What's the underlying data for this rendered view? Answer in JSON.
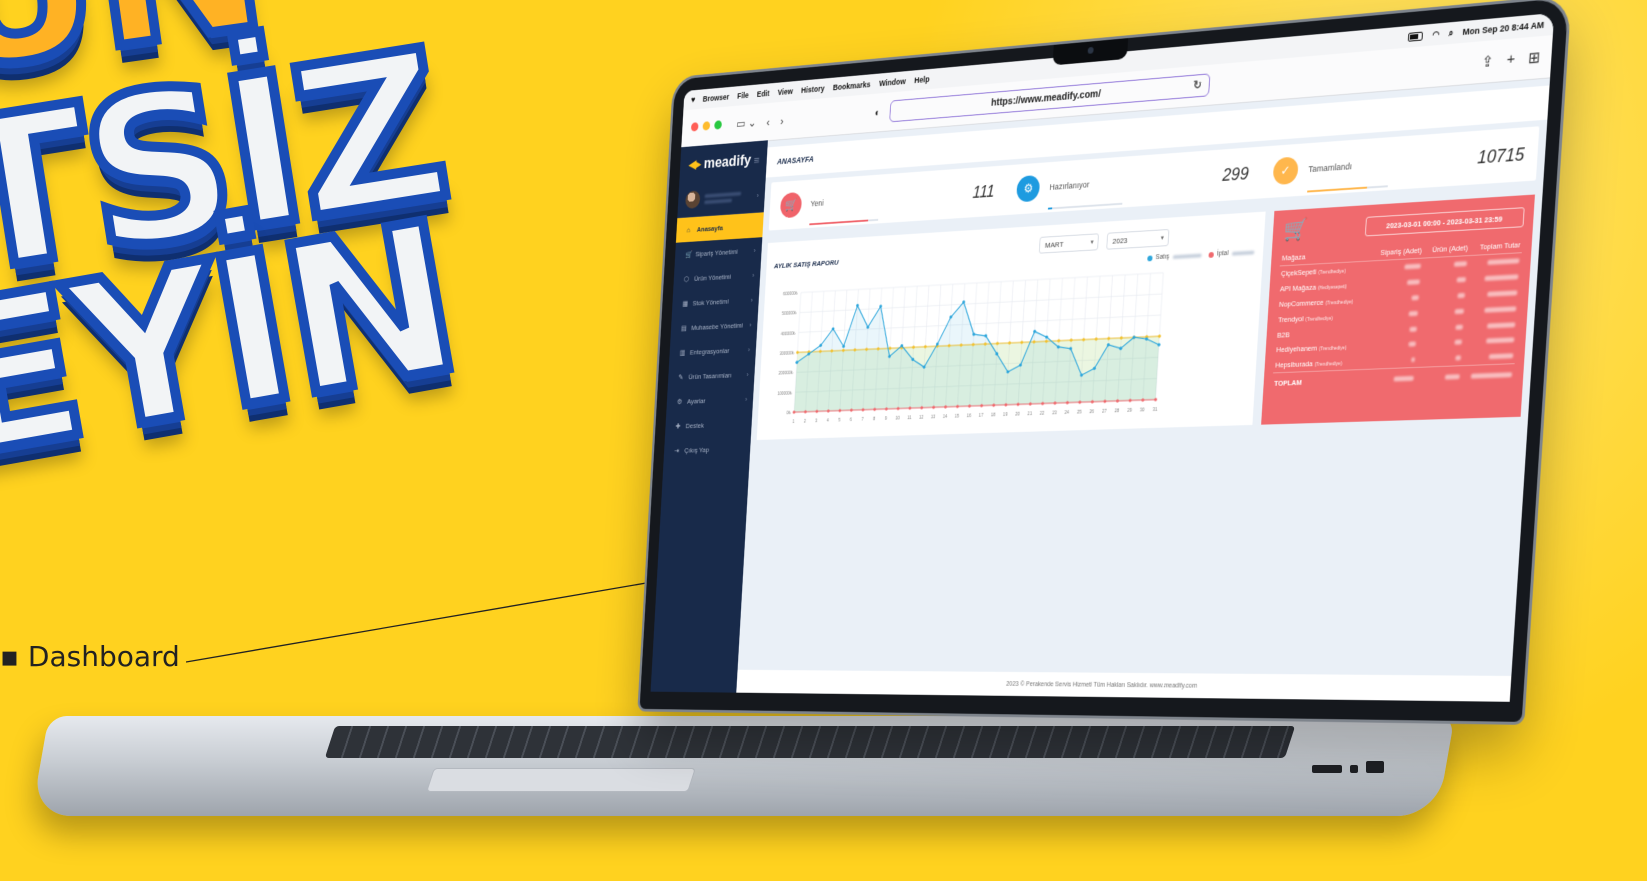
{
  "headline": {
    "line1": "UN",
    "line2": "TSİZ",
    "line3": "EYİN"
  },
  "callout": {
    "label": "Dashboard"
  },
  "menubar": {
    "items": [
      "Browser",
      "File",
      "Edit",
      "View",
      "History",
      "Bookmarks",
      "Window",
      "Help"
    ],
    "clock": "Mon Sep 20  8:44 AM"
  },
  "browser": {
    "url": "https://www.meadify.com/"
  },
  "app": {
    "logo": "meadify",
    "sidebar": {
      "items": [
        {
          "label": "Anasayfa",
          "icon": "home-icon",
          "active": true
        },
        {
          "label": "Sipariş Yönetimi",
          "icon": "cart-icon"
        },
        {
          "label": "Ürün Yönetimi",
          "icon": "tag-icon"
        },
        {
          "label": "Stok Yönetimi",
          "icon": "boxes-icon"
        },
        {
          "label": "Muhasebe Yönetimi",
          "icon": "document-icon"
        },
        {
          "label": "Entegrasyonlar",
          "icon": "grid-icon"
        },
        {
          "label": "Ürün Tasarımları",
          "icon": "brush-icon"
        },
        {
          "label": "Ayarlar",
          "icon": "settings-icon"
        },
        {
          "label": "Destek",
          "icon": "support-icon"
        },
        {
          "label": "Çıkış Yap",
          "icon": "logout-icon"
        }
      ]
    },
    "page_title": "ANASAYFA",
    "stats": [
      {
        "label": "Yeni",
        "value": "111",
        "color": "#F0636A",
        "icon": "cart-icon"
      },
      {
        "label": "Hazırlanıyor",
        "value": "299",
        "color": "#1E9BE0",
        "icon": "gears-icon"
      },
      {
        "label": "Tamamlandı",
        "value": "10715",
        "color": "#FFB74D",
        "icon": "check-icon"
      }
    ],
    "report": {
      "title": "AYLIK SATIŞ RAPORU",
      "month": "MART",
      "year": "2023",
      "legend_sales": "Satış",
      "legend_cancel": "İptal"
    },
    "orders": {
      "date_range": "2023-03-01 00:00 - 2023-03-31 23:59",
      "columns": [
        "Mağaza",
        "Sipariş (Adet)",
        "Ürün (Adet)",
        "Toplam Tutar"
      ],
      "rows": [
        {
          "store": "ÇiçekSepeti",
          "tag": "(Trendhediye)"
        },
        {
          "store": "API Mağaza",
          "tag": "(Hediyesepeti)"
        },
        {
          "store": "NopCommerce",
          "tag": "(Trendhediye)"
        },
        {
          "store": "Trendyol",
          "tag": "(Trendhediye)"
        },
        {
          "store": "B2B",
          "tag": ""
        },
        {
          "store": "Hediyehanem",
          "tag": "(Trendhediye)"
        },
        {
          "store": "Hepsiburada",
          "tag": "(Trendhediye)"
        }
      ],
      "total_label": "TOPLAM"
    },
    "footer": "2023 © Perakende Servis Hizmeti Tüm Hakları Saklıdır. www.meadify.com"
  },
  "chart_data": {
    "type": "line",
    "title": "AYLIK SATIŞ RAPORU",
    "x": [
      1,
      2,
      3,
      4,
      5,
      6,
      7,
      8,
      9,
      10,
      11,
      12,
      13,
      14,
      15,
      16,
      17,
      18,
      19,
      20,
      21,
      22,
      23,
      24,
      25,
      26,
      27,
      28,
      29,
      30,
      31
    ],
    "ytick_labels": [
      "0₺",
      "100000₺",
      "200000₺",
      "300000₺",
      "400000₺",
      "500000₺",
      "600000₺"
    ],
    "ylim": [
      0,
      600000
    ],
    "series": [
      {
        "name": "Satış",
        "color": "#2FA7DC",
        "values": [
          250000,
          290000,
          330000,
          410000,
          320000,
          520000,
          410000,
          510000,
          260000,
          310000,
          240000,
          200000,
          310000,
          440000,
          510000,
          350000,
          340000,
          250000,
          160000,
          190000,
          350000,
          320000,
          270000,
          260000,
          130000,
          160000,
          270000,
          250000,
          300000,
          290000,
          260000
        ]
      },
      {
        "name": "İptal",
        "color": "#F06A6E",
        "values": [
          0,
          0,
          0,
          0,
          0,
          0,
          0,
          0,
          0,
          0,
          0,
          0,
          0,
          0,
          0,
          0,
          0,
          0,
          0,
          0,
          0,
          0,
          0,
          0,
          0,
          0,
          0,
          0,
          0,
          0,
          0
        ]
      },
      {
        "color": "#F2C230",
        "values": [
          300000,
          300000,
          300000,
          300000,
          300000,
          300000,
          300000,
          300000,
          300000,
          300000,
          300000,
          300000,
          300000,
          300000,
          300000,
          300000,
          300000,
          300000,
          300000,
          300000,
          300000,
          300000,
          300000,
          300000,
          300000,
          300000,
          300000,
          300000,
          300000,
          300000,
          300000
        ]
      }
    ],
    "grid": true,
    "legend": "top-right"
  }
}
